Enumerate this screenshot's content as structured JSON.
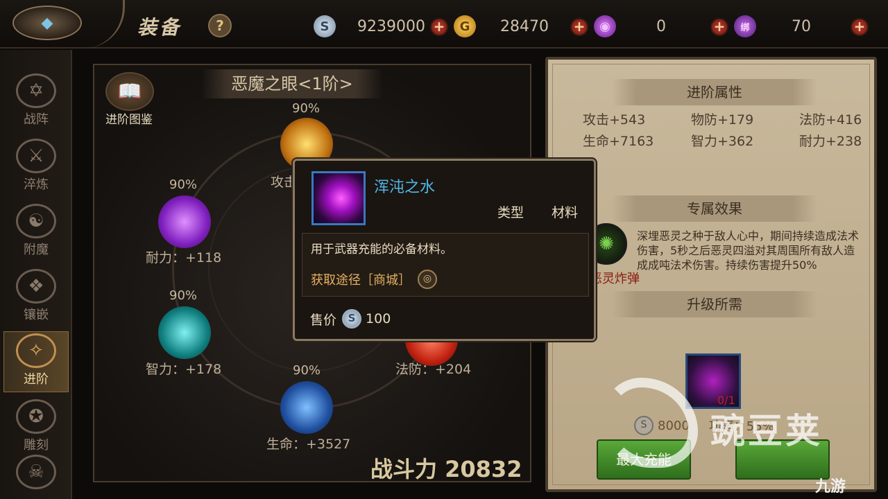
{
  "header": {
    "title": "装备",
    "help": "?",
    "back_icon": "diamond-arrow-icon"
  },
  "currencies": [
    {
      "icon": "silver-coin-icon",
      "glyph": "S",
      "value": "9239000",
      "color": "#9aa6b2"
    },
    {
      "icon": "gold-coin-icon",
      "glyph": "G",
      "value": "28470",
      "color": "#e0a020"
    },
    {
      "icon": "purple-gem-icon",
      "glyph": "◉",
      "value": "0",
      "color": "#9040c0"
    },
    {
      "icon": "bound-gem-icon",
      "glyph": "绑",
      "value": "70",
      "color": "#7040a0"
    }
  ],
  "sidebar": {
    "items": [
      {
        "label": "战阵",
        "glyph": "✡"
      },
      {
        "label": "淬炼",
        "glyph": "⚔"
      },
      {
        "label": "附魔",
        "glyph": "☯"
      },
      {
        "label": "镶嵌",
        "glyph": "❖"
      },
      {
        "label": "进阶",
        "glyph": "✧"
      },
      {
        "label": "雕刻",
        "glyph": "✪"
      },
      {
        "label": "",
        "glyph": "☠"
      }
    ],
    "active_index": 4
  },
  "left": {
    "gear_title": "恶魔之眼<1阶>",
    "book_label": "进阶图鉴",
    "orbs": [
      {
        "pct": "90%",
        "stat": "攻击",
        "color": "#e0a020"
      },
      {
        "pct": "90%",
        "stat": "耐力：+118",
        "color": "#a030d0"
      },
      {
        "pct": "90%",
        "stat": "智力：+178",
        "color": "#20a0a0"
      },
      {
        "pct": "90%",
        "stat": "生命：+3527",
        "color": "#3070c0"
      },
      {
        "pct": "",
        "stat": "法防：+204",
        "color": "#d03020"
      }
    ],
    "power_label": "战斗力 20832"
  },
  "right": {
    "attr_title": "进阶属性",
    "attrs": [
      "攻击+543",
      "物防+179",
      "法防+416",
      "生命+7163",
      "智力+362",
      "耐力+238"
    ],
    "effect_title": "专属效果",
    "skill_name": "恶灵炸弹",
    "skill_desc": "深埋恶灵之种于敌人心中，期间持续造成法术伤害，5秒之后恶灵四溢对其周围所有敌人造成成吨法术伤害。持续伤害提升50%",
    "upgrade_title": "升级所需",
    "material_count": "0/1",
    "cost_value": "8000",
    "success_rate": "功率：55%",
    "btn1": "最大充能",
    "btn2": ""
  },
  "tooltip": {
    "name": "浑沌之水",
    "type_label": "类型",
    "type_value": "材料",
    "desc": "用于武器充能的必备材料。",
    "source_label": "获取途径［商城］",
    "price_label": "售价",
    "price_value": "100"
  },
  "watermark": {
    "text": "豌豆荚",
    "site": "九游"
  }
}
